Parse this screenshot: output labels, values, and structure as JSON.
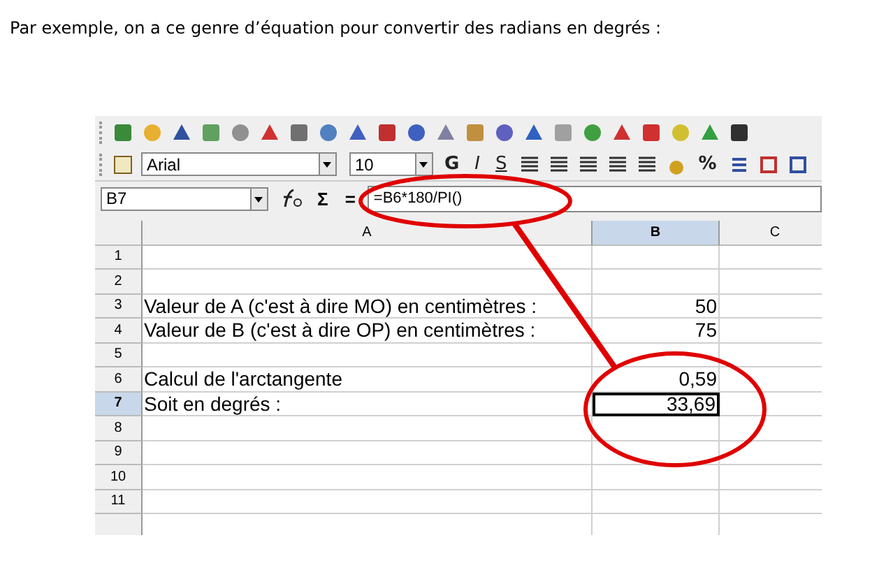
{
  "intro": "Par exemple, on a ce genre d’équation pour convertir des radians en degrés :",
  "font_box": {
    "value": "Arial"
  },
  "size_box": {
    "value": "10"
  },
  "format_buttons": [
    {
      "label": "G",
      "kind": "bold"
    },
    {
      "label": "I",
      "kind": "italic"
    },
    {
      "label": "S",
      "kind": "underline"
    }
  ],
  "percent_button": "%",
  "name_box": {
    "value": "B7"
  },
  "formula_bar": {
    "sum": "Σ",
    "equals": "=",
    "value": "=B6*180/PI()"
  },
  "columns": [
    {
      "label": "A",
      "selected": false
    },
    {
      "label": "B",
      "selected": true
    },
    {
      "label": "C",
      "selected": false
    }
  ],
  "rows": [
    {
      "number": "1",
      "selected": false,
      "b_active": false
    },
    {
      "number": "2",
      "selected": false,
      "b_active": false
    },
    {
      "number": "3",
      "selected": false,
      "b_active": false,
      "column_a": "Valeur de A (c'est à dire MO) en centimètres :",
      "column_b": "50"
    },
    {
      "number": "4",
      "selected": false,
      "b_active": false,
      "column_a": "Valeur de B (c'est à dire OP) en centimètres :",
      "column_b": "75"
    },
    {
      "number": "5",
      "selected": false,
      "b_active": false
    },
    {
      "number": "6",
      "selected": false,
      "b_active": false,
      "column_a": "Calcul de l'arctangente",
      "column_b": "0,59"
    },
    {
      "number": "7",
      "selected": true,
      "b_active": true,
      "column_a": "Soit en degrés :",
      "column_b": "33,69"
    },
    {
      "number": "8",
      "selected": false,
      "b_active": false
    },
    {
      "number": "9",
      "selected": false,
      "b_active": false
    },
    {
      "number": "10",
      "selected": false,
      "b_active": false
    },
    {
      "number": "11",
      "selected": false,
      "b_active": false
    }
  ]
}
